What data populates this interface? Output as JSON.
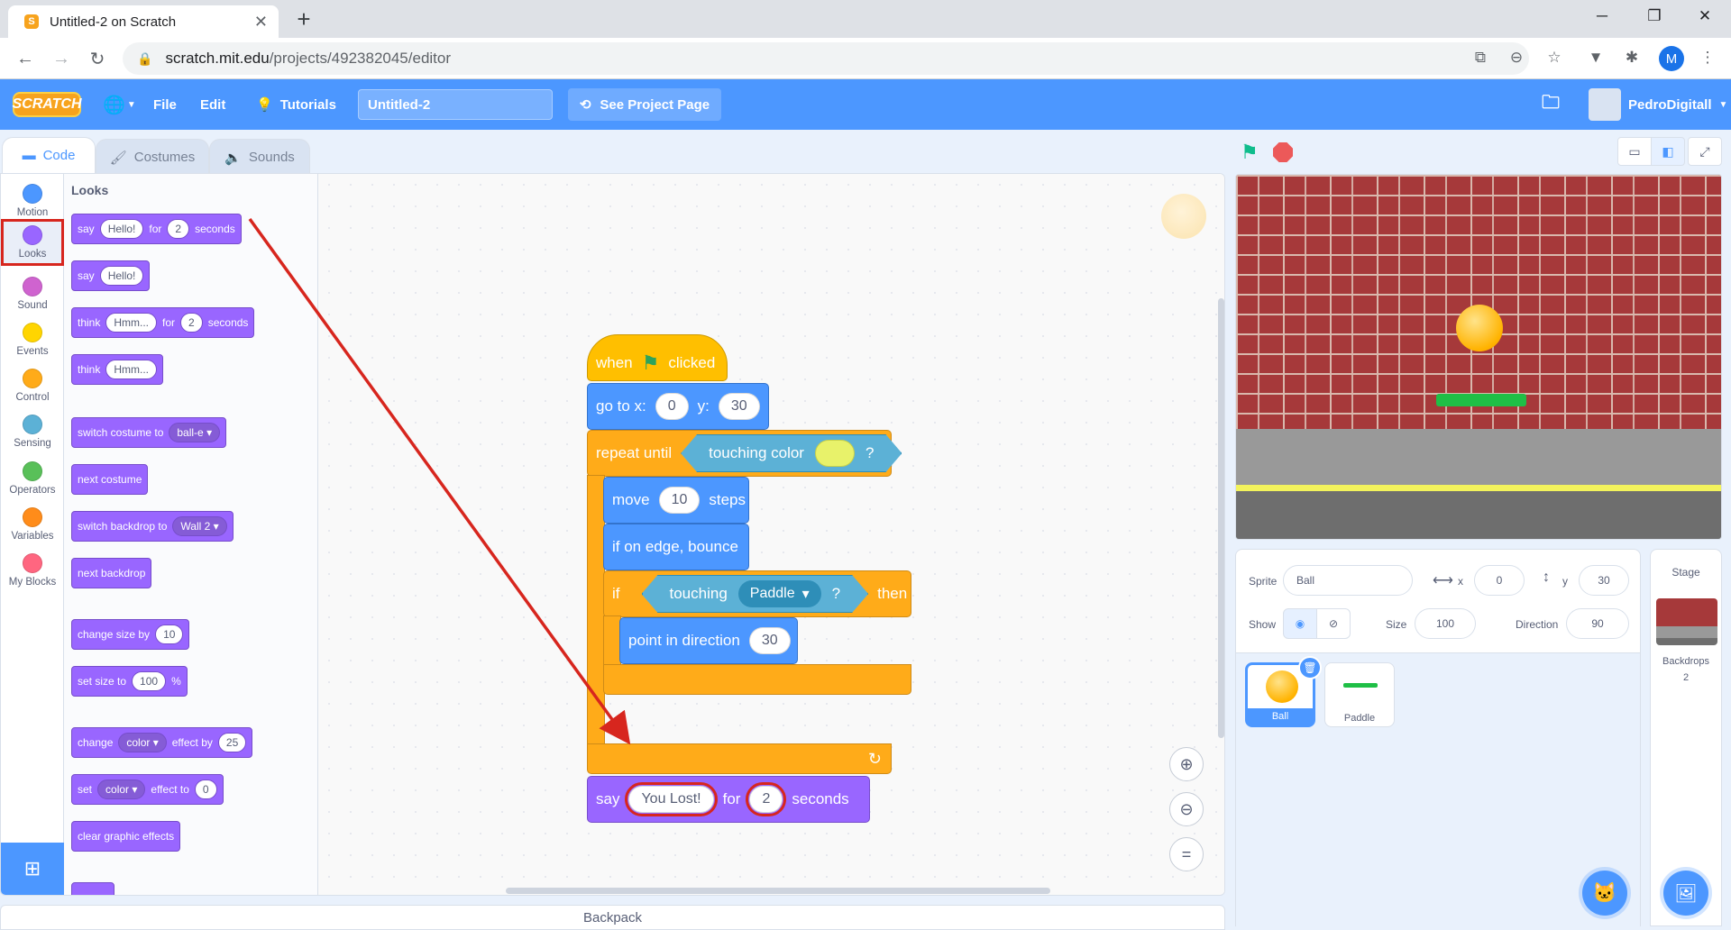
{
  "browser": {
    "tab_title": "Untitled-2 on Scratch",
    "url_host": "scratch.mit.edu",
    "url_path": "/projects/492382045/editor",
    "profile_initial": "M"
  },
  "menubar": {
    "logo": "SCRATCH",
    "file": "File",
    "edit": "Edit",
    "tutorials": "Tutorials",
    "project_title": "Untitled-2",
    "see_project": "See Project Page",
    "username": "PedroDigitall"
  },
  "tabs": {
    "code": "Code",
    "costumes": "Costumes",
    "sounds": "Sounds"
  },
  "categories": [
    {
      "label": "Motion",
      "color": "#4c97ff"
    },
    {
      "label": "Looks",
      "color": "#9966ff"
    },
    {
      "label": "Sound",
      "color": "#cf63cf"
    },
    {
      "label": "Events",
      "color": "#ffd500"
    },
    {
      "label": "Control",
      "color": "#ffab19"
    },
    {
      "label": "Sensing",
      "color": "#5cb1d6"
    },
    {
      "label": "Operators",
      "color": "#59c059"
    },
    {
      "label": "Variables",
      "color": "#ff8c1a"
    },
    {
      "label": "My Blocks",
      "color": "#ff6680"
    }
  ],
  "palette": {
    "title": "Looks",
    "say_for": {
      "say": "say",
      "msg": "Hello!",
      "for": "for",
      "secs": "2",
      "seconds": "seconds"
    },
    "say": {
      "say": "say",
      "msg": "Hello!"
    },
    "think_for": {
      "think": "think",
      "msg": "Hmm...",
      "for": "for",
      "secs": "2",
      "seconds": "seconds"
    },
    "think": {
      "think": "think",
      "msg": "Hmm..."
    },
    "switch_costume": {
      "label": "switch costume to",
      "value": "ball-e"
    },
    "next_costume": "next costume",
    "switch_backdrop": {
      "label": "switch backdrop to",
      "value": "Wall 2"
    },
    "next_backdrop": "next backdrop",
    "change_size": {
      "label": "change size by",
      "value": "10"
    },
    "set_size": {
      "label": "set size to",
      "value": "100",
      "unit": "%"
    },
    "change_effect": {
      "change": "change",
      "effect": "color",
      "by": "effect by",
      "value": "25"
    },
    "set_effect": {
      "set": "set",
      "effect": "color",
      "to": "effect to",
      "value": "0"
    },
    "clear_effects": "clear graphic effects"
  },
  "script": {
    "when": "when",
    "clicked": "clicked",
    "goto": "go to x:",
    "goto_x": "0",
    "goto_y_label": "y:",
    "goto_y": "30",
    "repeat_until": "repeat until",
    "touching_color": "touching color",
    "q": "?",
    "move": "move",
    "move_steps": "10",
    "steps": "steps",
    "bounce": "if on edge, bounce",
    "if": "if",
    "touching": "touching",
    "touching_target": "Paddle",
    "then": "then",
    "point": "point in direction",
    "point_val": "30",
    "say": "say",
    "say_msg": "You Lost!",
    "say_for": "for",
    "say_secs": "2",
    "seconds": "seconds"
  },
  "backpack": "Backpack",
  "sprite_info": {
    "sprite_label": "Sprite",
    "sprite_name": "Ball",
    "x_label": "x",
    "x": "0",
    "y_label": "y",
    "y": "30",
    "show_label": "Show",
    "size_label": "Size",
    "size": "100",
    "direction_label": "Direction",
    "direction": "90"
  },
  "sprites": [
    {
      "name": "Ball"
    },
    {
      "name": "Paddle"
    }
  ],
  "stage_panel": {
    "title": "Stage",
    "backdrops_label": "Backdrops",
    "backdrops_count": "2"
  },
  "colors": {
    "accent": "#4c97ff",
    "highlight": "#d7261e",
    "looks": "#9966ff",
    "control": "#ffab19",
    "sensing": "#5cb1d6",
    "events": "#ffbf00",
    "motion": "#4c97ff",
    "touch_color": "#e8f26a"
  }
}
